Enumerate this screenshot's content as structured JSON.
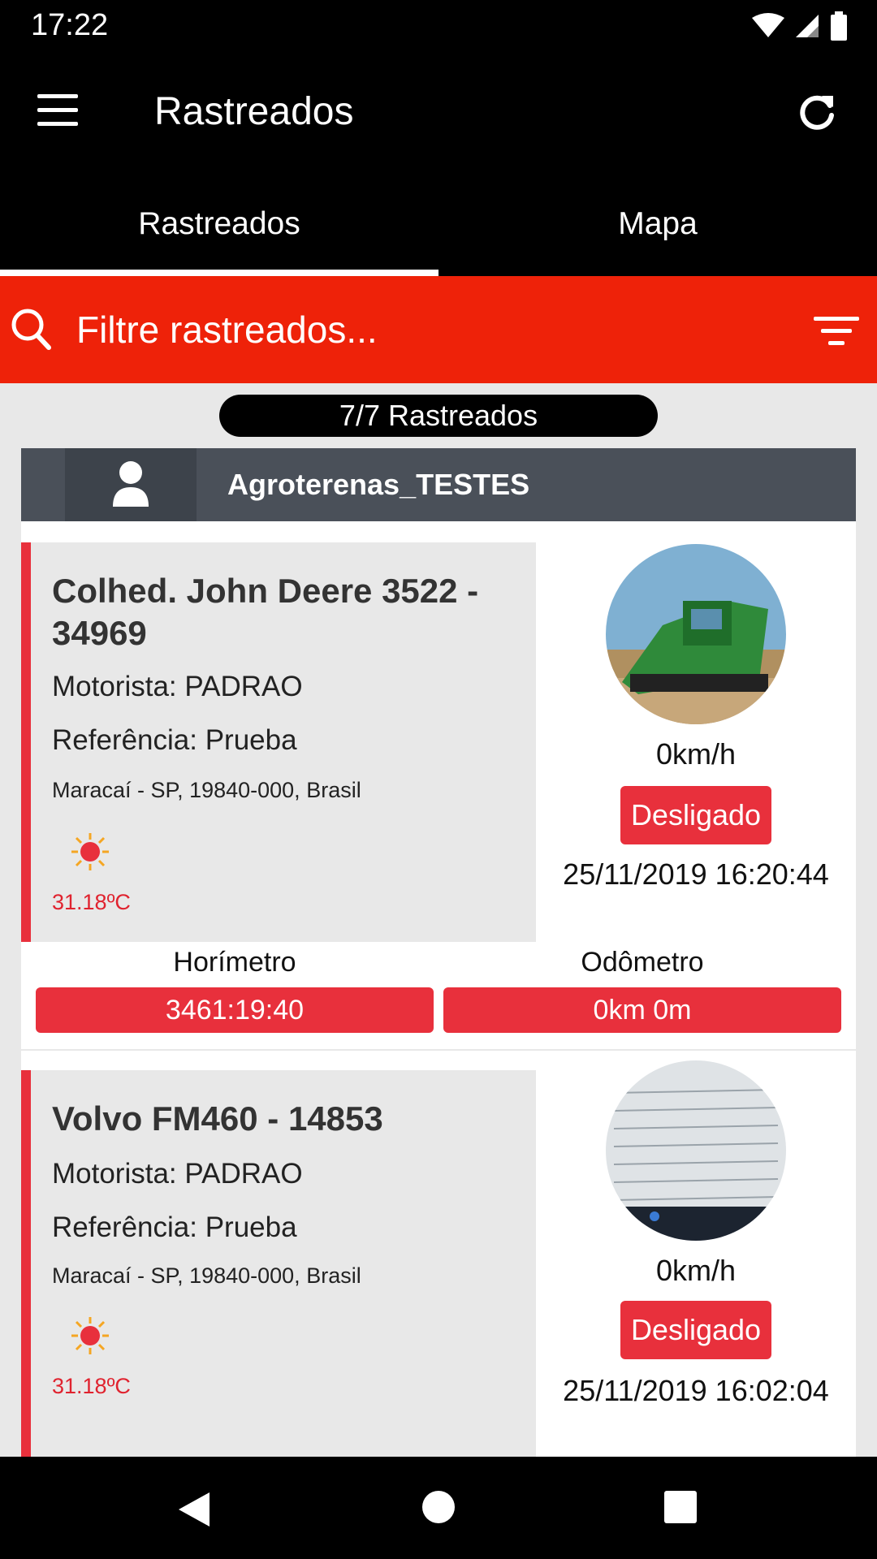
{
  "status_bar": {
    "time": "17:22"
  },
  "app_bar": {
    "title": "Rastreados"
  },
  "tabs": [
    {
      "label": "Rastreados",
      "active": true
    },
    {
      "label": "Mapa",
      "active": false
    }
  ],
  "search": {
    "placeholder": "Filtre rastreados..."
  },
  "count": "7/7 Rastreados",
  "group": {
    "name": "Agroterenas_TESTES"
  },
  "vehicles": [
    {
      "name": "Colhed. John Deere 3522 - 34969",
      "driver": "Motorista: PADRAO",
      "reference": "Referência: Prueba",
      "address": "Maracaí - SP, 19840-000, Brasil",
      "temperature": "31.18ºC",
      "speed": "0km/h",
      "status": "Desligado",
      "datetime": "25/11/2019 16:20:44",
      "horimetro_label": "Horímetro",
      "horimetro_value": "3461:19:40",
      "odometro_label": "Odômetro",
      "odometro_value": "0km 0m",
      "photo_icon": "harvester-photo"
    },
    {
      "name": "Volvo FM460 - 14853",
      "driver": "Motorista: PADRAO",
      "reference": "Referência: Prueba",
      "address": "Maracaí - SP, 19840-000, Brasil",
      "temperature": "31.18ºC",
      "speed": "0km/h",
      "status": "Desligado",
      "datetime": "25/11/2019 16:02:04",
      "photo_icon": "screen-photo"
    }
  ],
  "colors": {
    "accent": "#ee2209",
    "badge": "#e8303c",
    "header": "#4a5059"
  }
}
